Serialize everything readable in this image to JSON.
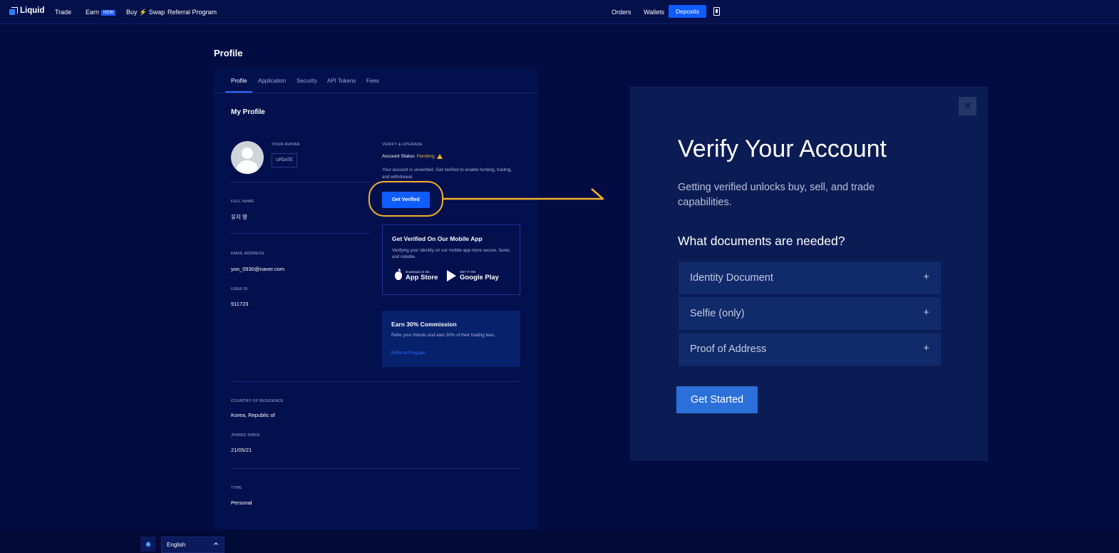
{
  "nav": {
    "logo": "Liquid",
    "trade": "Trade",
    "earn": "Earn",
    "earn_badge": "NEW",
    "buy_swap": "Buy ⚡ Swap",
    "referral": "Referral Program",
    "orders": "Orders",
    "wallets": "Wallets",
    "deposits": "Deposits"
  },
  "page": {
    "title": "Profile"
  },
  "tabs": [
    "Profile",
    "Application",
    "Security",
    "API Tokens",
    "Fees"
  ],
  "profile": {
    "section_title": "My Profile",
    "avatar_label": "YOUR AVATAR",
    "update_label": "UPDATE",
    "full_name_label": "FULL NAME",
    "full_name": "유지 영",
    "email_label": "EMAIL ADDRESS",
    "email": "yoo_0930@naver.com",
    "user_id_label": "USER ID",
    "user_id": "911723",
    "country_label": "COUNTRY OF RESIDENCE",
    "country": "Korea, Republic of",
    "joined_label": "JOINED SINCE",
    "joined": "21/05/21",
    "type_label": "TYPE",
    "type": "Personal"
  },
  "verify_upgrade": {
    "label": "VERIFY & UPGRADE",
    "status_label": "Account Status",
    "status_value": "Pending",
    "description": "Your account is unverified. Get verified to enable funding, trading, and withdrawal.",
    "button": "Get Verified"
  },
  "mobile_app": {
    "title": "Get Verified On Our Mobile App",
    "description": "Verifying your identity on our mobile app more secure, faster, and reliable.",
    "app_store_small": "Download on the",
    "app_store": "App Store",
    "google_play_small": "GET IT ON",
    "google_play": "Google Play"
  },
  "earn_commission": {
    "title": "Earn 30% Commission",
    "description": "Refer your friends and earn 30% of their trading fees.",
    "link": "Referral Program"
  },
  "verify_panel": {
    "close": "✕",
    "title": "Verify Your Account",
    "subtitle": "Getting verified unlocks buy, sell, and trade capabilities.",
    "docs_heading": "What documents are needed?",
    "docs": [
      {
        "label": "Identity Document",
        "toggle": "+"
      },
      {
        "label": "Selfie (only)",
        "toggle": "+"
      },
      {
        "label": "Proof of Address",
        "toggle": "+"
      }
    ],
    "cta": "Get Started"
  },
  "footer": {
    "language": "English"
  },
  "colors": {
    "background": "#020c42",
    "accent_blue": "#0f5cff",
    "highlight": "#f4b22b",
    "pending": "#f5b623",
    "panel": "#0b1c54"
  }
}
